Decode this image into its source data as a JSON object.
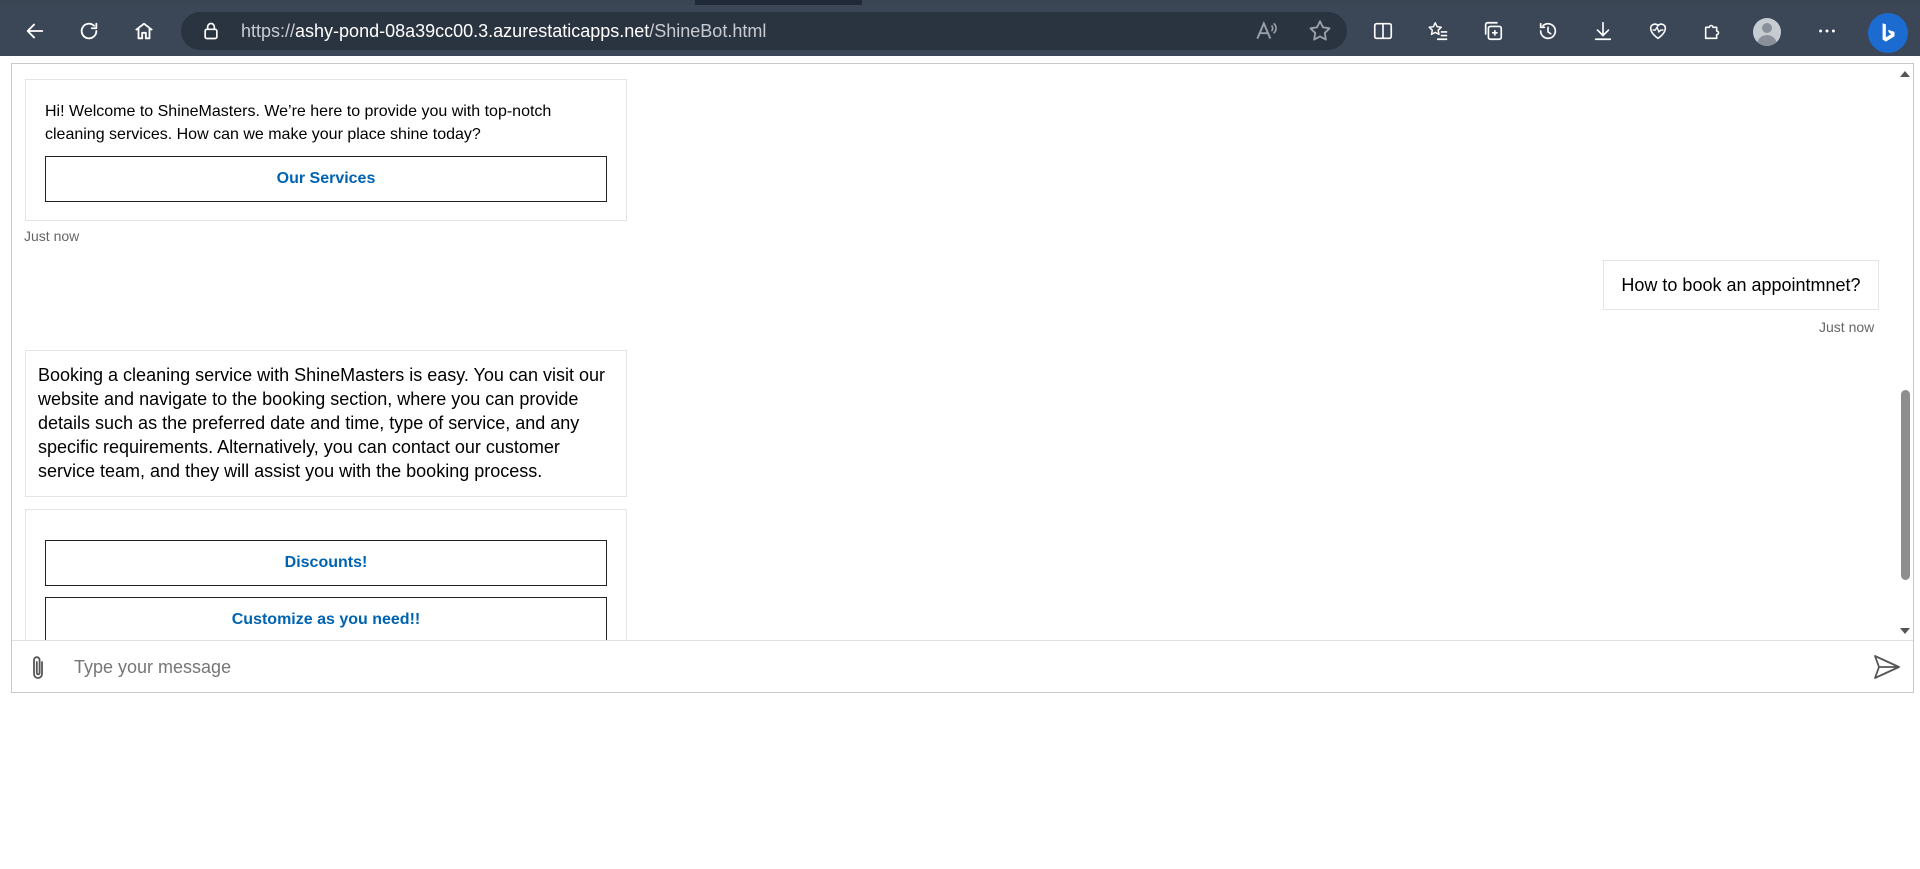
{
  "browser": {
    "url_prefix": "https://",
    "url_host": "ashy-pond-08a39cc00.3.azurestaticapps.net",
    "url_path": "/ShineBot.html"
  },
  "chat": {
    "welcome": {
      "text": "Hi! Welcome to ShineMasters. We’re here to provide you with top-notch cleaning services. How can we make your place shine today?",
      "button_label": "Our Services",
      "timestamp": "Just now"
    },
    "user_message": {
      "text": "How to book an appointmnet?",
      "timestamp": "Just now"
    },
    "bot_reply": {
      "text": "Booking a cleaning service with ShineMasters is easy. You can visit our website and navigate to the booking section, where you can provide details such as the preferred date and time, type of service, and any specific requirements. Alternatively, you can contact our customer service team, and they will assist you with the booking process."
    },
    "suggested_actions": [
      {
        "label": "Discounts!"
      },
      {
        "label": "Customize as you need!!"
      }
    ],
    "input_placeholder": "Type your message"
  },
  "colors": {
    "toolbar": "#3b4657",
    "action_text": "#0063b1",
    "bing_blue": "#1b6bd1"
  }
}
